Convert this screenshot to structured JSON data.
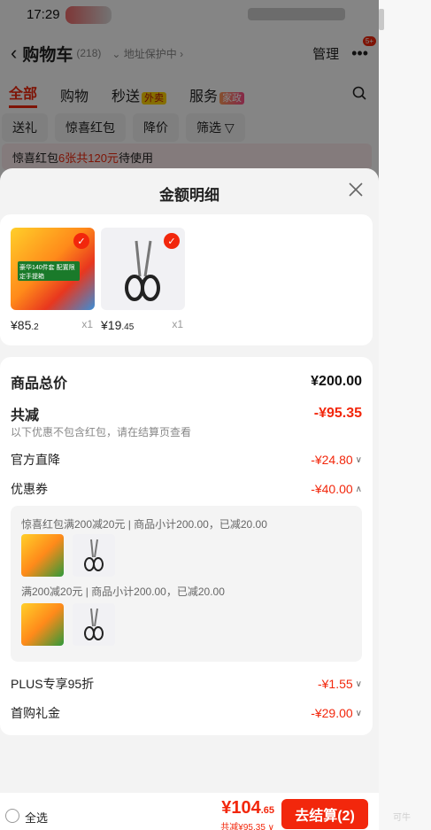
{
  "status_bar": {
    "time": "17:29"
  },
  "background": {
    "back_icon": "chevron-left-icon",
    "title": "购物车",
    "count": "(218)",
    "address": "地址保护中",
    "manage": "管理",
    "badge": "5+",
    "tabs": [
      {
        "label": "全部",
        "active": true
      },
      {
        "label": "购物"
      },
      {
        "label": "秒送",
        "tag": "外卖"
      },
      {
        "label": "服务",
        "tag": "家政"
      }
    ],
    "chips": [
      "送礼",
      "惊喜红包",
      "降价",
      "筛选"
    ],
    "banner": {
      "prefix": "惊喜红包",
      "highlight": "6张共120元",
      "suffix": "待使用"
    }
  },
  "sheet": {
    "title": "金额明细",
    "items": [
      {
        "price_int": "¥85",
        "price_dec": ".2",
        "qty": "x1",
        "image_text": "豪华140件套 配置限定手提箱"
      },
      {
        "price_int": "¥19",
        "price_dec": ".45",
        "qty": "x1"
      }
    ],
    "detail": {
      "total_label": "商品总价",
      "total_value": "¥200.00",
      "reduce_label": "共减",
      "reduce_value": "-¥95.35",
      "reduce_note": "以下优惠不包含红包，请在结算页查看",
      "official_label": "官方直降",
      "official_value": "-¥24.80",
      "coupon_label": "优惠券",
      "coupon_value": "-¥40.00",
      "coupon_lines": [
        "惊喜红包满200减20元 | 商品小计200.00，已减20.00",
        "满200减20元 | 商品小计200.00，已减20.00"
      ],
      "plus_label": "PLUS专享95折",
      "plus_value": "-¥1.55",
      "first_label": "首购礼金",
      "first_value": "-¥29.00"
    }
  },
  "bottom": {
    "select_all": "全选",
    "total_int": "¥104",
    "total_dec": ".65",
    "total_reduce": "共减¥95.35",
    "checkout": "去结算(2)"
  },
  "watermark": "可牛"
}
